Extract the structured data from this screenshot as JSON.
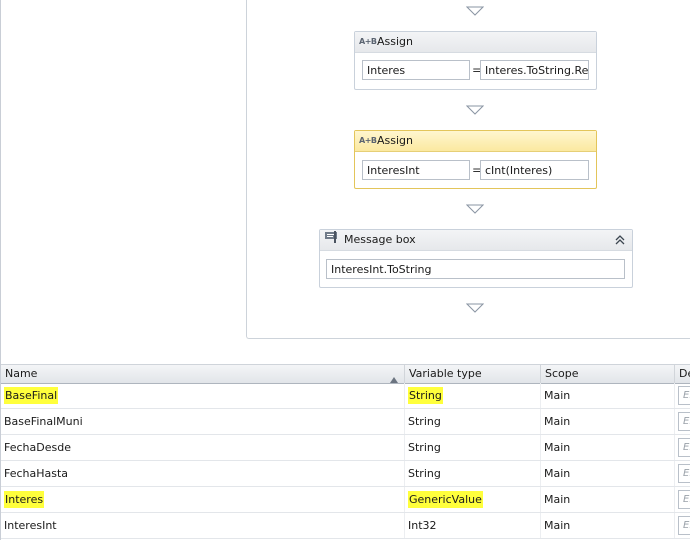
{
  "activities": {
    "assign1": {
      "title": "Assign",
      "to": "Interes",
      "value": "Interes.ToString.Rep",
      "icon": "assign-icon"
    },
    "assign2": {
      "title": "Assign",
      "to": "InteresInt",
      "value": "cInt(Interes)",
      "icon": "assign-icon"
    },
    "messagebox": {
      "title": "Message box",
      "text": "InteresInt.ToString",
      "icon": "message-box-icon"
    },
    "assign_icon_text": "A+B",
    "equals": "="
  },
  "variables": {
    "columns": [
      "Name",
      "Variable type",
      "Scope",
      "De"
    ],
    "rows": [
      {
        "name": "BaseFinal",
        "type": "String",
        "scope": "Main",
        "default": "En",
        "highlight": true
      },
      {
        "name": "BaseFinalMuni",
        "type": "String",
        "scope": "Main",
        "default": "En",
        "highlight": false
      },
      {
        "name": "FechaDesde",
        "type": "String",
        "scope": "Main",
        "default": "En",
        "highlight": false
      },
      {
        "name": "FechaHasta",
        "type": "String",
        "scope": "Main",
        "default": "En",
        "highlight": false
      },
      {
        "name": "Interes",
        "type": "GenericValue",
        "scope": "Main",
        "default": "En",
        "highlight": true
      },
      {
        "name": "InteresInt",
        "type": "Int32",
        "scope": "Main",
        "default": "En",
        "highlight": false
      }
    ]
  },
  "colors": {
    "highlight": "#ffff3c",
    "selected_border": "#e3c55a",
    "selected_header": "#fbe9a0"
  }
}
